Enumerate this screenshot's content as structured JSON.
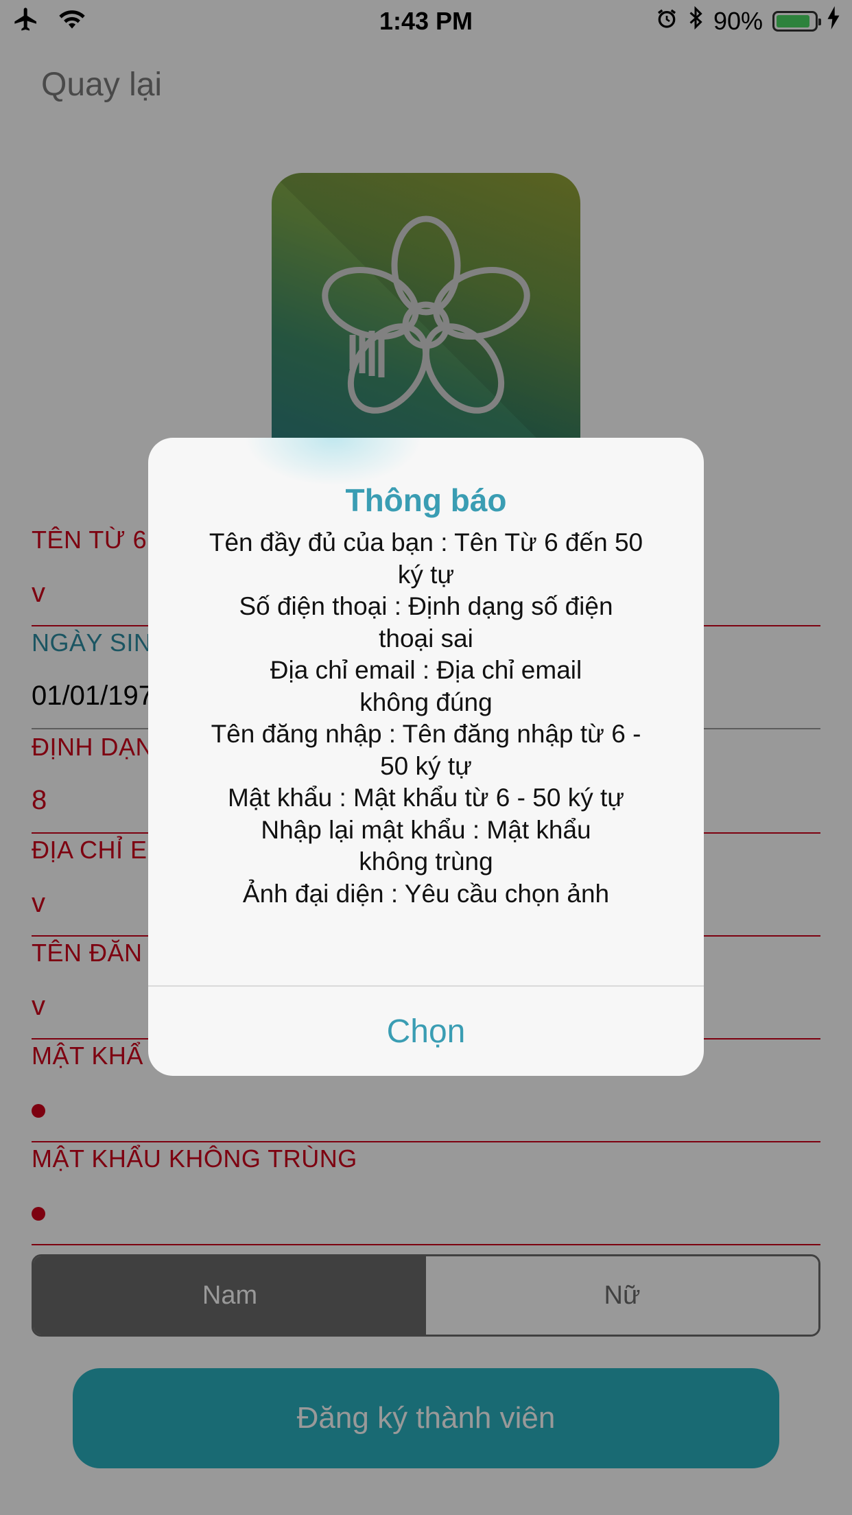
{
  "status_bar": {
    "time": "1:43 PM",
    "battery_text": "90%",
    "battery_level": 0.9,
    "icons": [
      "airplane-icon",
      "wifi-icon",
      "alarm-icon",
      "bluetooth-icon",
      "charging-bolt-icon"
    ]
  },
  "nav": {
    "back_label": "Quay lại"
  },
  "form": {
    "fields": [
      {
        "label": "TÊN TỪ 6",
        "value": "v"
      },
      {
        "label": "NGÀY SIN",
        "value": "01/01/197"
      },
      {
        "label": "ĐỊNH DẠN",
        "value": "8"
      },
      {
        "label": "ĐỊA CHỈ E",
        "value": "v"
      },
      {
        "label": "TÊN ĐĂN",
        "value": "v"
      },
      {
        "label": "MẬT KHẨ",
        "value": ""
      },
      {
        "label": "MẬT KHẨU KHÔNG TRÙNG",
        "value": ""
      }
    ],
    "gender": {
      "options": [
        "Nam",
        "Nữ"
      ],
      "selected": "Nam"
    },
    "submit_label": "Đăng ký thành viên"
  },
  "colors": {
    "error_red": "#d0021b",
    "accent_teal": "#2ab1c0",
    "alert_title": "#3a9db3"
  },
  "alert": {
    "title": "Thông báo",
    "lines": [
      "Tên đầy đủ của bạn :  Tên Từ 6 đến 50",
      "ký tự",
      "Số điện thoại :  Định dạng số điện",
      "thoại sai",
      "Địa chỉ email :  Địa chỉ email",
      "không đúng",
      "Tên đăng nhập :  Tên đăng nhập từ 6 -",
      "50 ký tự",
      "Mật khẩu :  Mật khẩu từ 6 - 50 ký tự",
      "Nhập lại mật khẩu :  Mật khẩu",
      "không trùng",
      "Ảnh đại diện :  Yêu cầu chọn ảnh"
    ],
    "button_label": "Chọn"
  }
}
